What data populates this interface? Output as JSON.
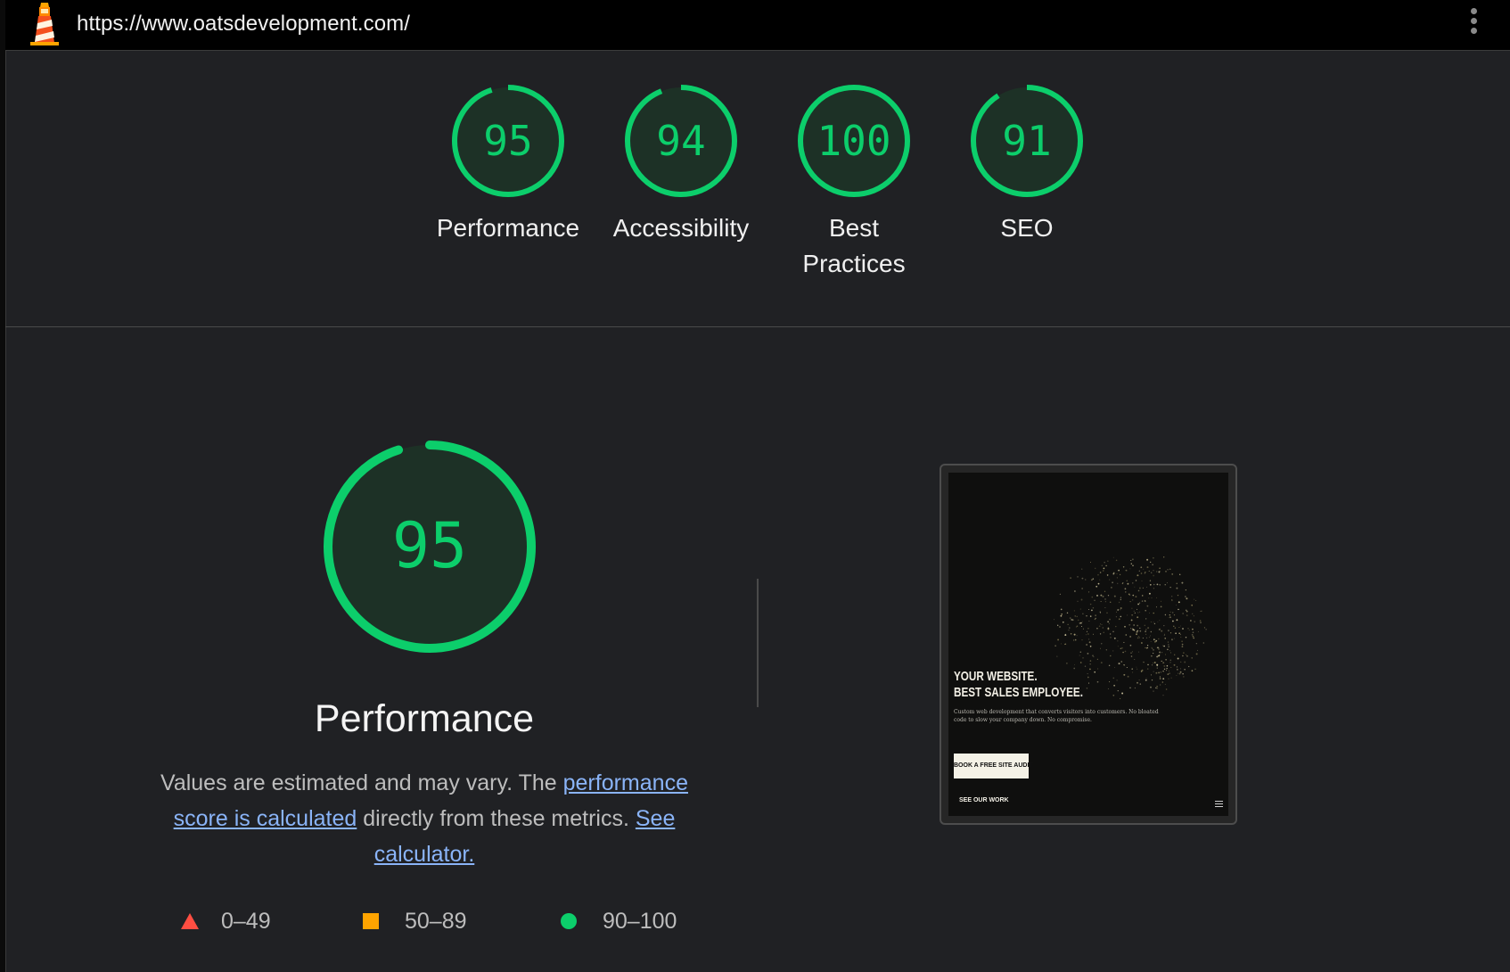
{
  "topbar": {
    "url": "https://www.oatsdevelopment.com/",
    "logo_icon": "lighthouse-icon",
    "menu_icon": "kebab-menu-icon"
  },
  "colors": {
    "pass": "#0cce6b",
    "average": "#ffa400",
    "fail": "#ff4e42",
    "link": "#8ab4f8"
  },
  "scores": [
    {
      "id": "performance",
      "value": "95",
      "score": 95,
      "label": "Performance"
    },
    {
      "id": "accessibility",
      "value": "94",
      "score": 94,
      "label": "Accessibility"
    },
    {
      "id": "best-practices",
      "value": "100",
      "score": 100,
      "label": "Best Practices"
    },
    {
      "id": "seo",
      "value": "91",
      "score": 91,
      "label": "SEO"
    }
  ],
  "performance_section": {
    "score": "95",
    "score_value": 95,
    "title": "Performance",
    "desc_prefix": "Values are estimated and may vary. The ",
    "desc_link1": "performance score is calculated",
    "desc_middle": " directly from these metrics. ",
    "desc_link2": "See calculator."
  },
  "legend": [
    {
      "shape": "triangle",
      "range": "0–49"
    },
    {
      "shape": "square",
      "range": "50–89"
    },
    {
      "shape": "circle",
      "range": "90–100"
    }
  ],
  "screenshot": {
    "headline_line1": "YOUR WEBSITE.",
    "headline_line2": "BEST SALES EMPLOYEE.",
    "subtext": "Custom web development that converts visitors into customers. No bloated code to slow your company down. No compromise.",
    "cta": "BOOK A FREE SITE AUDIT",
    "secondary": "SEE OUR WORK",
    "menu_icon": "hamburger-icon"
  }
}
